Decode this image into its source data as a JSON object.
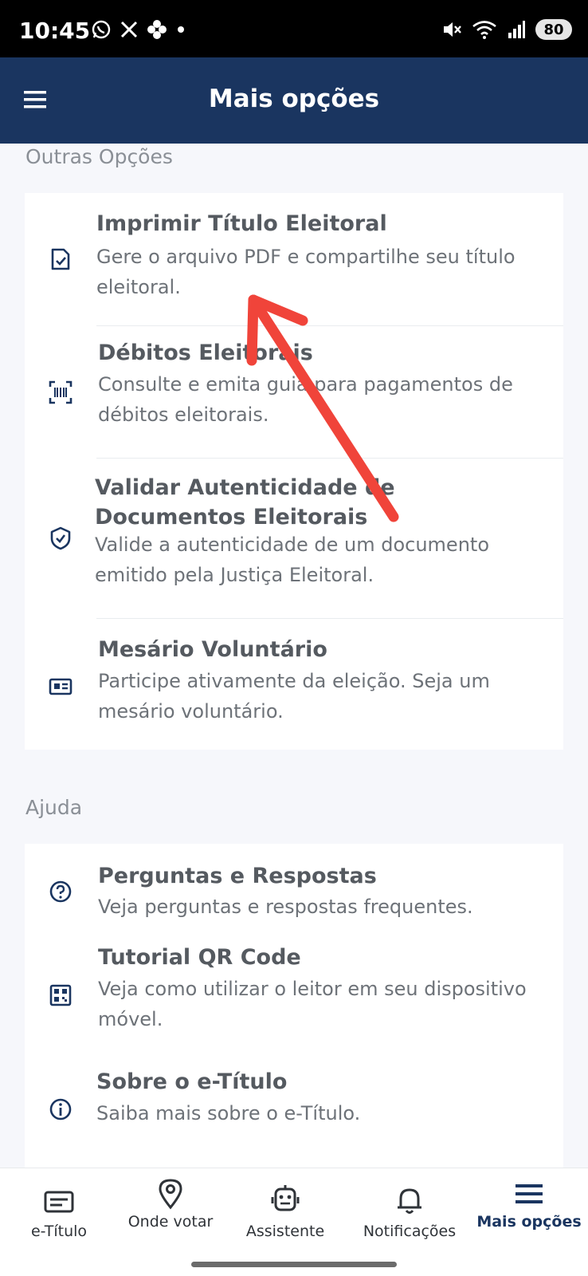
{
  "status_bar": {
    "time": "10:45",
    "battery": "80",
    "left_icons": [
      "whatsapp-icon",
      "x-icon",
      "flower-icon",
      "dot-icon"
    ],
    "right_icons": [
      "mute-icon",
      "wifi-icon",
      "signal-icon"
    ]
  },
  "app_bar": {
    "title": "Mais opções"
  },
  "sections": [
    {
      "title": "Outras Opções",
      "items": [
        {
          "icon": "document-check-icon",
          "title": "Imprimir Título Eleitoral",
          "subtitle": "Gere o arquivo PDF e compartilhe seu título eleitoral."
        },
        {
          "icon": "barcode-scan-icon",
          "title": "Débitos Eleitorais",
          "subtitle": "Consulte e emita guia para pagamentos de débitos eleitorais."
        },
        {
          "icon": "shield-check-icon",
          "title": "Validar Autenticidade de Documentos Eleitorais",
          "subtitle": "Valide a autenticidade de um documento emitido pela Justiça Eleitoral."
        },
        {
          "icon": "id-card-icon",
          "title": "Mesário Voluntário",
          "subtitle": "Participe ativamente da eleição. Seja um mesário voluntário."
        }
      ]
    },
    {
      "title": "Ajuda",
      "items": [
        {
          "icon": "question-circle-icon",
          "title": "Perguntas e Respostas",
          "subtitle": "Veja perguntas e respostas frequentes."
        },
        {
          "icon": "qr-code-icon",
          "title": "Tutorial QR Code",
          "subtitle": "Veja como utilizar o leitor em seu dispositivo móvel."
        },
        {
          "icon": "info-circle-icon",
          "title": "Sobre o e-Título",
          "subtitle": "Saiba mais sobre o e-Título."
        }
      ]
    }
  ],
  "bottom_nav": [
    {
      "icon": "title-card-icon",
      "label": "e-Título",
      "active": false
    },
    {
      "icon": "location-pin-icon",
      "label": "Onde votar",
      "active": false
    },
    {
      "icon": "assistant-robot-icon",
      "label": "Assistente",
      "active": false
    },
    {
      "icon": "bell-icon",
      "label": "Notificações",
      "active": false
    },
    {
      "icon": "menu-icon",
      "label": "Mais opções",
      "active": true
    }
  ],
  "colors": {
    "primary": "#1a3560",
    "background": "#f6f7fb",
    "annotation_arrow": "#f0443a"
  }
}
